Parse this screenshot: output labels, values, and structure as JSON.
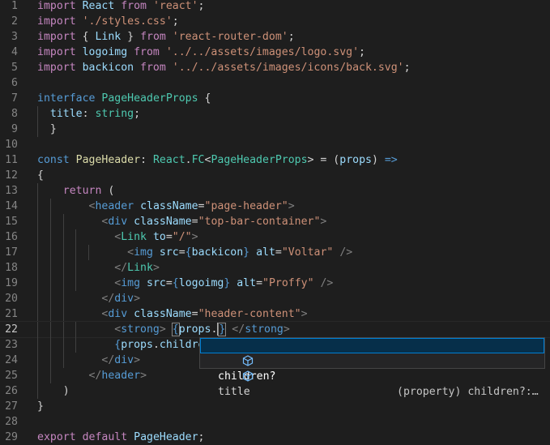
{
  "editor": {
    "lines": [
      {
        "n": "1",
        "indent": 0,
        "tokens": [
          {
            "t": "import",
            "c": "ki"
          },
          {
            "t": " React ",
            "c": "v"
          },
          {
            "t": "from",
            "c": "ki"
          },
          {
            "t": " ",
            "c": "p"
          },
          {
            "t": "'react'",
            "c": "s"
          },
          {
            "t": ";",
            "c": "p"
          }
        ]
      },
      {
        "n": "2",
        "indent": 0,
        "tokens": [
          {
            "t": "import",
            "c": "ki"
          },
          {
            "t": " ",
            "c": "p"
          },
          {
            "t": "'./styles.css'",
            "c": "s"
          },
          {
            "t": ";",
            "c": "p"
          }
        ]
      },
      {
        "n": "3",
        "indent": 0,
        "tokens": [
          {
            "t": "import",
            "c": "ki"
          },
          {
            "t": " { ",
            "c": "p"
          },
          {
            "t": "Link",
            "c": "v"
          },
          {
            "t": " } ",
            "c": "p"
          },
          {
            "t": "from",
            "c": "ki"
          },
          {
            "t": " ",
            "c": "p"
          },
          {
            "t": "'react-router-dom'",
            "c": "s"
          },
          {
            "t": ";",
            "c": "p"
          }
        ]
      },
      {
        "n": "4",
        "indent": 0,
        "tokens": [
          {
            "t": "import",
            "c": "ki"
          },
          {
            "t": " logoimg ",
            "c": "v"
          },
          {
            "t": "from",
            "c": "ki"
          },
          {
            "t": " ",
            "c": "p"
          },
          {
            "t": "'../../assets/images/logo.svg'",
            "c": "s"
          },
          {
            "t": ";",
            "c": "p"
          }
        ]
      },
      {
        "n": "5",
        "indent": 0,
        "tokens": [
          {
            "t": "import",
            "c": "ki"
          },
          {
            "t": " backicon ",
            "c": "v"
          },
          {
            "t": "from",
            "c": "ki"
          },
          {
            "t": " ",
            "c": "p"
          },
          {
            "t": "'../../assets/images/icons/back.svg'",
            "c": "s"
          },
          {
            "t": ";",
            "c": "p"
          }
        ]
      },
      {
        "n": "6",
        "indent": 0,
        "tokens": []
      },
      {
        "n": "7",
        "indent": 0,
        "tokens": [
          {
            "t": "interface",
            "c": "k"
          },
          {
            "t": " ",
            "c": "p"
          },
          {
            "t": "PageHeaderProps",
            "c": "t"
          },
          {
            "t": " {",
            "c": "p"
          }
        ]
      },
      {
        "n": "8",
        "indent": 1,
        "tokens": [
          {
            "t": "  title",
            "c": "v"
          },
          {
            "t": ": ",
            "c": "p"
          },
          {
            "t": "string",
            "c": "t"
          },
          {
            "t": ";",
            "c": "p"
          }
        ]
      },
      {
        "n": "9",
        "indent": 1,
        "tokens": [
          {
            "t": "  }",
            "c": "p"
          }
        ]
      },
      {
        "n": "10",
        "indent": 0,
        "tokens": []
      },
      {
        "n": "11",
        "indent": 0,
        "tokens": [
          {
            "t": "const",
            "c": "k"
          },
          {
            "t": " ",
            "c": "p"
          },
          {
            "t": "PageHeader",
            "c": "f"
          },
          {
            "t": ": ",
            "c": "p"
          },
          {
            "t": "React",
            "c": "t"
          },
          {
            "t": ".",
            "c": "p"
          },
          {
            "t": "FC",
            "c": "t"
          },
          {
            "t": "<",
            "c": "p"
          },
          {
            "t": "PageHeaderProps",
            "c": "t"
          },
          {
            "t": "> = (",
            "c": "p"
          },
          {
            "t": "props",
            "c": "v"
          },
          {
            "t": ") ",
            "c": "p"
          },
          {
            "t": "=>",
            "c": "k"
          }
        ]
      },
      {
        "n": "12",
        "indent": 0,
        "tokens": [
          {
            "t": "{",
            "c": "p"
          }
        ]
      },
      {
        "n": "13",
        "indent": 1,
        "tokens": [
          {
            "t": "    ",
            "c": "p"
          },
          {
            "t": "return",
            "c": "ki"
          },
          {
            "t": " (",
            "c": "p"
          }
        ]
      },
      {
        "n": "14",
        "indent": 2,
        "tokens": [
          {
            "t": "        ",
            "c": "p"
          },
          {
            "t": "<",
            "c": "tg"
          },
          {
            "t": "header",
            "c": "tn"
          },
          {
            "t": " ",
            "c": "p"
          },
          {
            "t": "className",
            "c": "v"
          },
          {
            "t": "=",
            "c": "p"
          },
          {
            "t": "\"page-header\"",
            "c": "s"
          },
          {
            "t": ">",
            "c": "tg"
          }
        ]
      },
      {
        "n": "15",
        "indent": 3,
        "tokens": [
          {
            "t": "          ",
            "c": "p"
          },
          {
            "t": "<",
            "c": "tg"
          },
          {
            "t": "div",
            "c": "tn"
          },
          {
            "t": " ",
            "c": "p"
          },
          {
            "t": "className",
            "c": "v"
          },
          {
            "t": "=",
            "c": "p"
          },
          {
            "t": "\"top-bar-container\"",
            "c": "s"
          },
          {
            "t": ">",
            "c": "tg"
          }
        ]
      },
      {
        "n": "16",
        "indent": 4,
        "tokens": [
          {
            "t": "            ",
            "c": "p"
          },
          {
            "t": "<",
            "c": "tg"
          },
          {
            "t": "Link",
            "c": "t"
          },
          {
            "t": " ",
            "c": "p"
          },
          {
            "t": "to",
            "c": "v"
          },
          {
            "t": "=",
            "c": "p"
          },
          {
            "t": "\"/\"",
            "c": "s"
          },
          {
            "t": ">",
            "c": "tg"
          }
        ]
      },
      {
        "n": "17",
        "indent": 5,
        "tokens": [
          {
            "t": "              ",
            "c": "p"
          },
          {
            "t": "<",
            "c": "tg"
          },
          {
            "t": "img",
            "c": "tn"
          },
          {
            "t": " ",
            "c": "p"
          },
          {
            "t": "src",
            "c": "v"
          },
          {
            "t": "=",
            "c": "p"
          },
          {
            "t": "{",
            "c": "k"
          },
          {
            "t": "backicon",
            "c": "v"
          },
          {
            "t": "}",
            "c": "k"
          },
          {
            "t": " ",
            "c": "p"
          },
          {
            "t": "alt",
            "c": "v"
          },
          {
            "t": "=",
            "c": "p"
          },
          {
            "t": "\"Voltar\"",
            "c": "s"
          },
          {
            "t": " />",
            "c": "tg"
          }
        ]
      },
      {
        "n": "18",
        "indent": 4,
        "tokens": [
          {
            "t": "            ",
            "c": "p"
          },
          {
            "t": "</",
            "c": "tg"
          },
          {
            "t": "Link",
            "c": "t"
          },
          {
            "t": ">",
            "c": "tg"
          }
        ]
      },
      {
        "n": "19",
        "indent": 4,
        "tokens": [
          {
            "t": "            ",
            "c": "p"
          },
          {
            "t": "<",
            "c": "tg"
          },
          {
            "t": "img",
            "c": "tn"
          },
          {
            "t": " ",
            "c": "p"
          },
          {
            "t": "src",
            "c": "v"
          },
          {
            "t": "=",
            "c": "p"
          },
          {
            "t": "{",
            "c": "k"
          },
          {
            "t": "logoimg",
            "c": "v"
          },
          {
            "t": "}",
            "c": "k"
          },
          {
            "t": " ",
            "c": "p"
          },
          {
            "t": "alt",
            "c": "v"
          },
          {
            "t": "=",
            "c": "p"
          },
          {
            "t": "\"Proffy\"",
            "c": "s"
          },
          {
            "t": " />",
            "c": "tg"
          }
        ]
      },
      {
        "n": "20",
        "indent": 3,
        "tokens": [
          {
            "t": "          ",
            "c": "p"
          },
          {
            "t": "</",
            "c": "tg"
          },
          {
            "t": "div",
            "c": "tn"
          },
          {
            "t": ">",
            "c": "tg"
          }
        ]
      },
      {
        "n": "21",
        "indent": 3,
        "tokens": [
          {
            "t": "          ",
            "c": "p"
          },
          {
            "t": "<",
            "c": "tg"
          },
          {
            "t": "div",
            "c": "tn"
          },
          {
            "t": " ",
            "c": "p"
          },
          {
            "t": "className",
            "c": "v"
          },
          {
            "t": "=",
            "c": "p"
          },
          {
            "t": "\"header-content\"",
            "c": "s"
          },
          {
            "t": ">",
            "c": "tg"
          }
        ]
      },
      {
        "n": "22",
        "indent": 4,
        "current": true,
        "tokens": [
          {
            "t": "            ",
            "c": "p"
          },
          {
            "t": "<",
            "c": "tg"
          },
          {
            "t": "strong",
            "c": "tn"
          },
          {
            "t": ">",
            "c": "tg"
          },
          {
            "t": " ",
            "c": "p"
          },
          {
            "t": "{",
            "c": "k",
            "b": true
          },
          {
            "t": "props",
            "c": "v"
          },
          {
            "t": ".",
            "c": "p"
          },
          {
            "t": "",
            "c": "cursor"
          },
          {
            "t": "}",
            "c": "k",
            "b": true
          },
          {
            "t": " ",
            "c": "p"
          },
          {
            "t": "</",
            "c": "tg"
          },
          {
            "t": "strong",
            "c": "tn"
          },
          {
            "t": ">",
            "c": "tg"
          }
        ]
      },
      {
        "n": "23",
        "indent": 4,
        "tokens": [
          {
            "t": "            ",
            "c": "p"
          },
          {
            "t": "{",
            "c": "k"
          },
          {
            "t": "props",
            "c": "v"
          },
          {
            "t": ".",
            "c": "p"
          },
          {
            "t": "children",
            "c": "v"
          },
          {
            "t": "}",
            "c": "k"
          }
        ]
      },
      {
        "n": "24",
        "indent": 3,
        "tokens": [
          {
            "t": "          ",
            "c": "p"
          },
          {
            "t": "</",
            "c": "tg"
          },
          {
            "t": "div",
            "c": "tn"
          },
          {
            "t": ">",
            "c": "tg"
          }
        ]
      },
      {
        "n": "25",
        "indent": 2,
        "tokens": [
          {
            "t": "        ",
            "c": "p"
          },
          {
            "t": "</",
            "c": "tg"
          },
          {
            "t": "header",
            "c": "tn"
          },
          {
            "t": ">",
            "c": "tg"
          }
        ]
      },
      {
        "n": "26",
        "indent": 1,
        "tokens": [
          {
            "t": "    )",
            "c": "p"
          }
        ]
      },
      {
        "n": "27",
        "indent": 0,
        "tokens": [
          {
            "t": "}",
            "c": "p"
          }
        ]
      },
      {
        "n": "28",
        "indent": 0,
        "tokens": []
      },
      {
        "n": "29",
        "indent": 0,
        "tokens": [
          {
            "t": "export",
            "c": "ki"
          },
          {
            "t": " ",
            "c": "p"
          },
          {
            "t": "default",
            "c": "ki"
          },
          {
            "t": " ",
            "c": "p"
          },
          {
            "t": "PageHeader",
            "c": "v"
          },
          {
            "t": ";",
            "c": "p"
          }
        ]
      }
    ]
  },
  "suggest": {
    "items": [
      {
        "label": "children?",
        "detail": "(property) children?:…",
        "selected": true,
        "icon": "property-icon"
      },
      {
        "label": "title",
        "detail": "",
        "selected": false,
        "icon": "property-icon"
      }
    ]
  }
}
